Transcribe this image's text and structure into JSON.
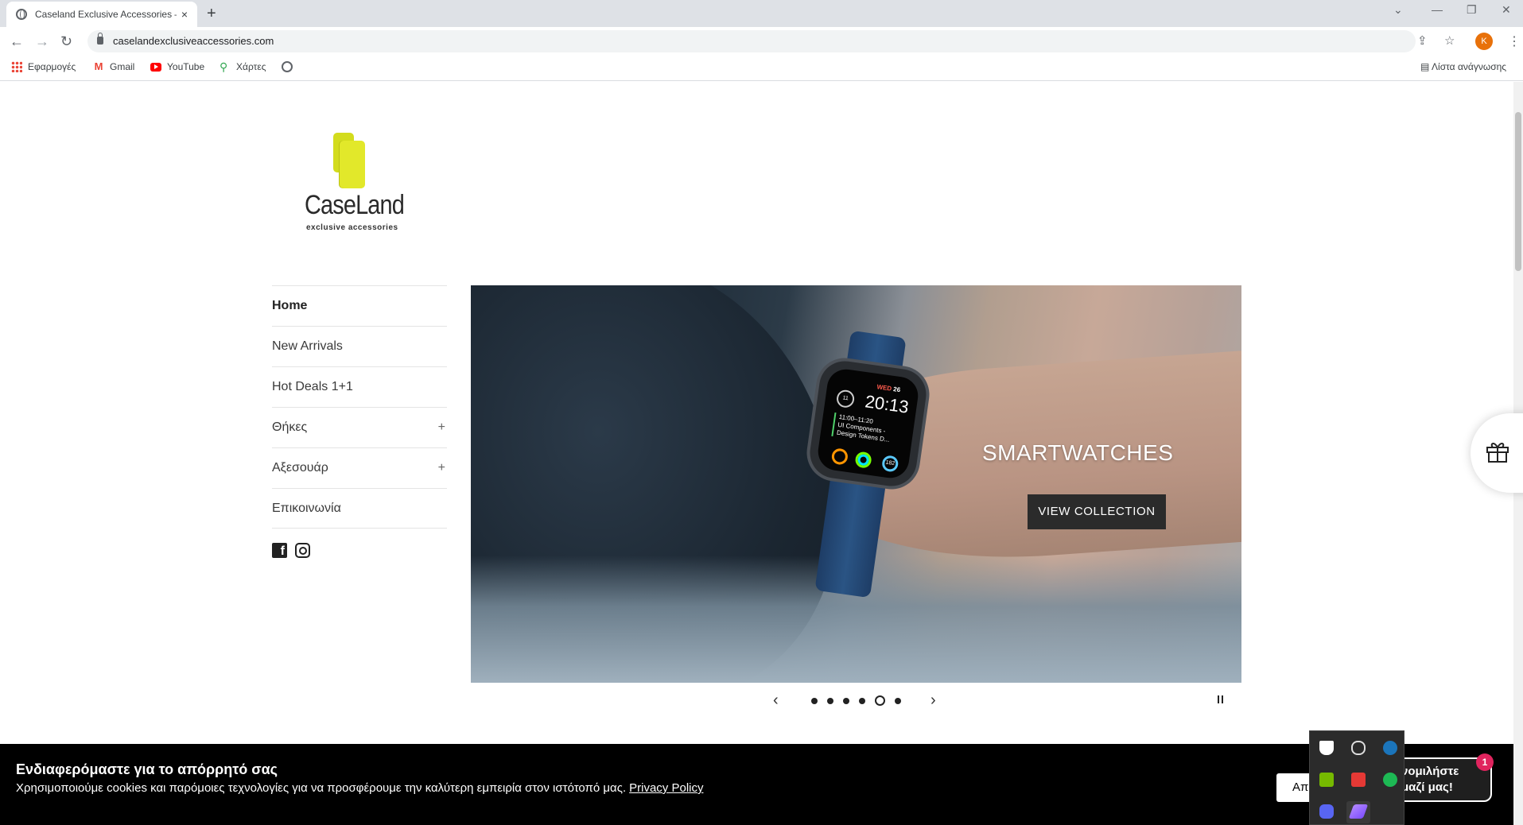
{
  "browser": {
    "tab_title": "Caseland Exclusive Accessories –",
    "tab_close": "×",
    "new_tab": "+",
    "url": "caselandexclusiveaccessories.com",
    "profile_initial": "K",
    "bookmarks": [
      {
        "label": "Εφαρμογές",
        "icon": "apps-icon"
      },
      {
        "label": "Gmail",
        "icon": "gmail-icon"
      },
      {
        "label": "YouTube",
        "icon": "youtube-icon"
      },
      {
        "label": "Χάρτες",
        "icon": "maps-icon"
      }
    ],
    "reading_list": "Λίστα ανάγνωσης"
  },
  "logo": {
    "brand": "CaseLand",
    "tagline": "exclusive accessories"
  },
  "nav": {
    "items": [
      {
        "label": "Home",
        "active": true,
        "expandable": false
      },
      {
        "label": "New Arrivals",
        "active": false,
        "expandable": false
      },
      {
        "label": "Hot Deals 1+1",
        "active": false,
        "expandable": false
      },
      {
        "label": "Θήκες",
        "active": false,
        "expandable": true
      },
      {
        "label": "Αξεσουάρ",
        "active": false,
        "expandable": true
      },
      {
        "label": "Επικοινωνία",
        "active": false,
        "expandable": false
      }
    ],
    "expand_symbol": "+"
  },
  "social": [
    "facebook-icon",
    "instagram-icon"
  ],
  "slideshow": {
    "heading": "SMARTWATCHES",
    "cta": "VIEW COLLECTION",
    "slide_count": 6,
    "active_slide": 5,
    "watch": {
      "date_day": "WED",
      "date_num": "26",
      "time": "20:13",
      "event_time": "11:00–11:20",
      "event_line1": "UI Components -",
      "event_line2": "Design Tokens D...",
      "ring_value": "182",
      "dial_value": "11"
    }
  },
  "cookie": {
    "title": "Ενδιαφερόμαστε για το απόρρητό σας",
    "text": "Χρησιμοποιούμε cookies και παρόμοιες τεχνολογίες για να προσφέρουμε την καλύτερη εμπειρία στον ιστότοπό μας.",
    "link": "Privacy Policy",
    "accept_label": "Απ"
  },
  "chat": {
    "line1": "νομιλήστε",
    "line2": "μαζί μας!",
    "badge": "1"
  },
  "colors": {
    "accent_logo": "#d3dc1d",
    "cookie_bg": "#000000",
    "cta_bg": "#2b2b2b",
    "badge": "#e0245e"
  }
}
